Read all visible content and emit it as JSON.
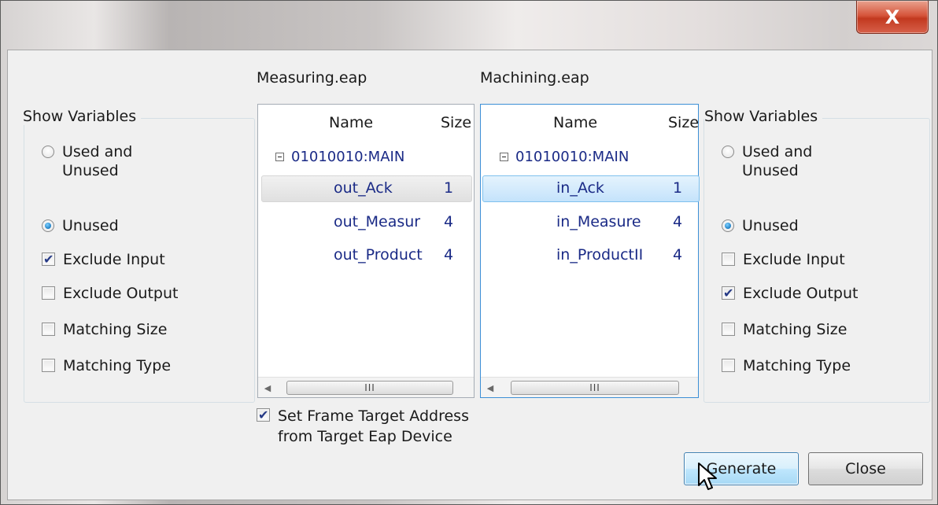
{
  "window": {
    "close_label": "X"
  },
  "left_panel": {
    "group_title": "Show Variables",
    "option_used_unused": "Used and\nUnused",
    "option_unused": "Unused",
    "exclude_input": "Exclude Input",
    "exclude_output": "Exclude Output",
    "matching_size": "Matching Size",
    "matching_type": "Matching Type",
    "selected": "Unused",
    "checked": [
      "Exclude Input"
    ]
  },
  "right_panel": {
    "group_title": "Show Variables",
    "option_used_unused": "Used and\nUnused",
    "option_unused": "Unused",
    "exclude_input": "Exclude Input",
    "exclude_output": "Exclude Output",
    "matching_size": "Matching Size",
    "matching_type": "Matching Type",
    "selected": "Unused",
    "checked": [
      "Exclude Output"
    ]
  },
  "source_list": {
    "file": "Measuring.eap",
    "col_name": "Name",
    "col_size": "Size",
    "root": "01010010:MAIN",
    "rows": [
      {
        "name": "out_Ack",
        "size": "1"
      },
      {
        "name": "out_Measur",
        "size": "4"
      },
      {
        "name": "out_Product",
        "size": "4"
      }
    ],
    "scroll_grip": "III"
  },
  "target_list": {
    "file": "Machining.eap",
    "col_name": "Name",
    "col_size": "Size",
    "root": "01010010:MAIN",
    "rows": [
      {
        "name": "in_Ack",
        "size": "1"
      },
      {
        "name": "in_Measure",
        "size": "4"
      },
      {
        "name": "in_ProductII",
        "size": "4"
      }
    ],
    "scroll_grip": "III"
  },
  "set_frame_target": {
    "label": "Set Frame Target Address\nfrom Target Eap Device",
    "checked": true
  },
  "buttons": {
    "generate": "Generate",
    "close": "Close"
  }
}
